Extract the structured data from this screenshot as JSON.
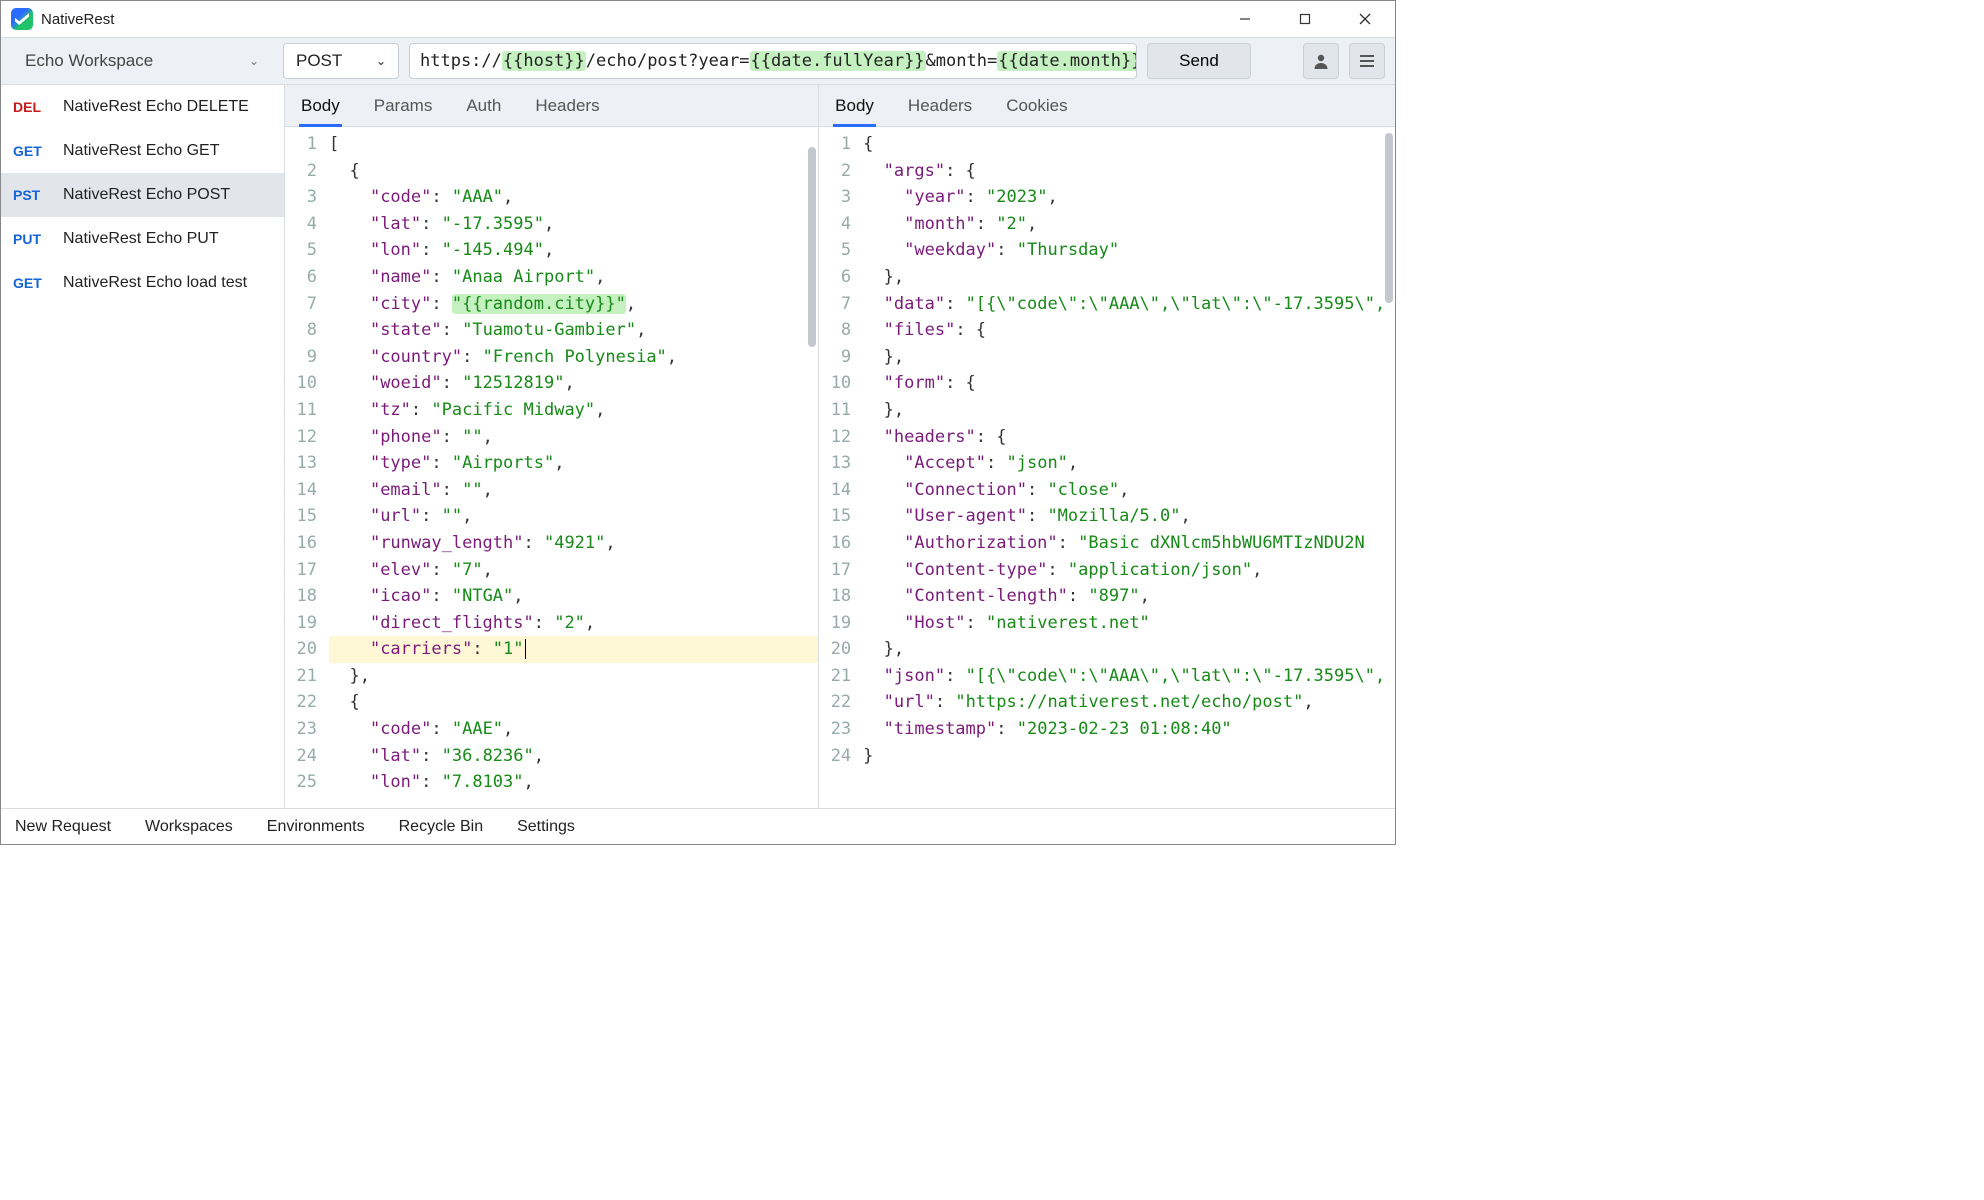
{
  "app": {
    "title": "NativeRest"
  },
  "workspace": {
    "name": "Echo Workspace"
  },
  "request_bar": {
    "method": "POST",
    "url_parts": {
      "p0": "https://",
      "v0": "{{host}}",
      "p1": "/echo/post?year=",
      "v1": "{{date.fullYear}}",
      "p2": "&month=",
      "v2": "{{date.month}}"
    },
    "send": "Send"
  },
  "sidebar": [
    {
      "method": "DEL",
      "cls": "m-del",
      "label": "NativeRest Echo DELETE"
    },
    {
      "method": "GET",
      "cls": "m-get",
      "label": "NativeRest Echo GET"
    },
    {
      "method": "PST",
      "cls": "m-pst",
      "label": "NativeRest Echo POST",
      "selected": true
    },
    {
      "method": "PUT",
      "cls": "m-put",
      "label": "NativeRest Echo PUT"
    },
    {
      "method": "GET",
      "cls": "m-get",
      "label": "NativeRest Echo load test"
    }
  ],
  "req_tabs": [
    "Body",
    "Params",
    "Auth",
    "Headers"
  ],
  "resp_tabs": [
    "Body",
    "Headers",
    "Cookies"
  ],
  "request_body": [
    {
      "n": 1,
      "i": 0,
      "t": [
        [
          "p",
          "["
        ]
      ]
    },
    {
      "n": 2,
      "i": 1,
      "t": [
        [
          "p",
          "{"
        ]
      ]
    },
    {
      "n": 3,
      "i": 2,
      "t": [
        [
          "k",
          "\"code\""
        ],
        [
          "p",
          ": "
        ],
        [
          "s",
          "\"AAA\""
        ],
        [
          "p",
          ","
        ]
      ]
    },
    {
      "n": 4,
      "i": 2,
      "t": [
        [
          "k",
          "\"lat\""
        ],
        [
          "p",
          ": "
        ],
        [
          "s",
          "\"-17.3595\""
        ],
        [
          "p",
          ","
        ]
      ]
    },
    {
      "n": 5,
      "i": 2,
      "t": [
        [
          "k",
          "\"lon\""
        ],
        [
          "p",
          ": "
        ],
        [
          "s",
          "\"-145.494\""
        ],
        [
          "p",
          ","
        ]
      ]
    },
    {
      "n": 6,
      "i": 2,
      "t": [
        [
          "k",
          "\"name\""
        ],
        [
          "p",
          ": "
        ],
        [
          "s",
          "\"Anaa Airport\""
        ],
        [
          "p",
          ","
        ]
      ]
    },
    {
      "n": 7,
      "i": 2,
      "t": [
        [
          "k",
          "\"city\""
        ],
        [
          "p",
          ": "
        ],
        [
          "s v",
          "\"{{random.city}}\""
        ],
        [
          "p",
          ","
        ]
      ]
    },
    {
      "n": 8,
      "i": 2,
      "t": [
        [
          "k",
          "\"state\""
        ],
        [
          "p",
          ": "
        ],
        [
          "s",
          "\"Tuamotu-Gambier\""
        ],
        [
          "p",
          ","
        ]
      ]
    },
    {
      "n": 9,
      "i": 2,
      "t": [
        [
          "k",
          "\"country\""
        ],
        [
          "p",
          ": "
        ],
        [
          "s",
          "\"French Polynesia\""
        ],
        [
          "p",
          ","
        ]
      ]
    },
    {
      "n": 10,
      "i": 2,
      "t": [
        [
          "k",
          "\"woeid\""
        ],
        [
          "p",
          ": "
        ],
        [
          "s",
          "\"12512819\""
        ],
        [
          "p",
          ","
        ]
      ]
    },
    {
      "n": 11,
      "i": 2,
      "t": [
        [
          "k",
          "\"tz\""
        ],
        [
          "p",
          ": "
        ],
        [
          "s",
          "\"Pacific Midway\""
        ],
        [
          "p",
          ","
        ]
      ]
    },
    {
      "n": 12,
      "i": 2,
      "t": [
        [
          "k",
          "\"phone\""
        ],
        [
          "p",
          ": "
        ],
        [
          "s",
          "\"\""
        ],
        [
          "p",
          ","
        ]
      ]
    },
    {
      "n": 13,
      "i": 2,
      "t": [
        [
          "k",
          "\"type\""
        ],
        [
          "p",
          ": "
        ],
        [
          "s",
          "\"Airports\""
        ],
        [
          "p",
          ","
        ]
      ]
    },
    {
      "n": 14,
      "i": 2,
      "t": [
        [
          "k",
          "\"email\""
        ],
        [
          "p",
          ": "
        ],
        [
          "s",
          "\"\""
        ],
        [
          "p",
          ","
        ]
      ]
    },
    {
      "n": 15,
      "i": 2,
      "t": [
        [
          "k",
          "\"url\""
        ],
        [
          "p",
          ": "
        ],
        [
          "s",
          "\"\""
        ],
        [
          "p",
          ","
        ]
      ]
    },
    {
      "n": 16,
      "i": 2,
      "t": [
        [
          "k",
          "\"runway_length\""
        ],
        [
          "p",
          ": "
        ],
        [
          "s",
          "\"4921\""
        ],
        [
          "p",
          ","
        ]
      ]
    },
    {
      "n": 17,
      "i": 2,
      "t": [
        [
          "k",
          "\"elev\""
        ],
        [
          "p",
          ": "
        ],
        [
          "s",
          "\"7\""
        ],
        [
          "p",
          ","
        ]
      ]
    },
    {
      "n": 18,
      "i": 2,
      "t": [
        [
          "k",
          "\"icao\""
        ],
        [
          "p",
          ": "
        ],
        [
          "s",
          "\"NTGA\""
        ],
        [
          "p",
          ","
        ]
      ]
    },
    {
      "n": 19,
      "i": 2,
      "t": [
        [
          "k",
          "\"direct_flights\""
        ],
        [
          "p",
          ": "
        ],
        [
          "s",
          "\"2\""
        ],
        [
          "p",
          ","
        ]
      ]
    },
    {
      "n": 20,
      "i": 2,
      "hl": true,
      "cursor": true,
      "t": [
        [
          "k",
          "\"carriers\""
        ],
        [
          "p",
          ": "
        ],
        [
          "s",
          "\"1\""
        ]
      ]
    },
    {
      "n": 21,
      "i": 1,
      "t": [
        [
          "p",
          "},"
        ]
      ]
    },
    {
      "n": 22,
      "i": 1,
      "t": [
        [
          "p",
          "{"
        ]
      ]
    },
    {
      "n": 23,
      "i": 2,
      "t": [
        [
          "k",
          "\"code\""
        ],
        [
          "p",
          ": "
        ],
        [
          "s",
          "\"AAE\""
        ],
        [
          "p",
          ","
        ]
      ]
    },
    {
      "n": 24,
      "i": 2,
      "t": [
        [
          "k",
          "\"lat\""
        ],
        [
          "p",
          ": "
        ],
        [
          "s",
          "\"36.8236\""
        ],
        [
          "p",
          ","
        ]
      ]
    },
    {
      "n": 25,
      "i": 2,
      "t": [
        [
          "k",
          "\"lon\""
        ],
        [
          "p",
          ": "
        ],
        [
          "s",
          "\"7.8103\""
        ],
        [
          "p",
          ","
        ]
      ]
    }
  ],
  "response_body": [
    {
      "n": 1,
      "i": 0,
      "t": [
        [
          "p",
          "{"
        ]
      ]
    },
    {
      "n": 2,
      "i": 1,
      "t": [
        [
          "k",
          "\"args\""
        ],
        [
          "p",
          ": {"
        ]
      ]
    },
    {
      "n": 3,
      "i": 2,
      "t": [
        [
          "k",
          "\"year\""
        ],
        [
          "p",
          ": "
        ],
        [
          "s",
          "\"2023\""
        ],
        [
          "p",
          ","
        ]
      ]
    },
    {
      "n": 4,
      "i": 2,
      "t": [
        [
          "k",
          "\"month\""
        ],
        [
          "p",
          ": "
        ],
        [
          "s",
          "\"2\""
        ],
        [
          "p",
          ","
        ]
      ]
    },
    {
      "n": 5,
      "i": 2,
      "t": [
        [
          "k",
          "\"weekday\""
        ],
        [
          "p",
          ": "
        ],
        [
          "s",
          "\"Thursday\""
        ]
      ]
    },
    {
      "n": 6,
      "i": 1,
      "t": [
        [
          "p",
          "},"
        ]
      ]
    },
    {
      "n": 7,
      "i": 1,
      "t": [
        [
          "k",
          "\"data\""
        ],
        [
          "p",
          ": "
        ],
        [
          "s",
          "\"[{\\\"code\\\":\\\"AAA\\\",\\\"lat\\\":\\\"-17.3595\\\","
        ],
        [
          "p",
          ""
        ]
      ]
    },
    {
      "n": 8,
      "i": 1,
      "t": [
        [
          "k",
          "\"files\""
        ],
        [
          "p",
          ": {"
        ]
      ]
    },
    {
      "n": 9,
      "i": 1,
      "t": [
        [
          "p",
          "},"
        ]
      ]
    },
    {
      "n": 10,
      "i": 1,
      "t": [
        [
          "k",
          "\"form\""
        ],
        [
          "p",
          ": {"
        ]
      ]
    },
    {
      "n": 11,
      "i": 1,
      "t": [
        [
          "p",
          "},"
        ]
      ]
    },
    {
      "n": 12,
      "i": 1,
      "t": [
        [
          "k",
          "\"headers\""
        ],
        [
          "p",
          ": {"
        ]
      ]
    },
    {
      "n": 13,
      "i": 2,
      "t": [
        [
          "k",
          "\"Accept\""
        ],
        [
          "p",
          ": "
        ],
        [
          "s",
          "\"json\""
        ],
        [
          "p",
          ","
        ]
      ]
    },
    {
      "n": 14,
      "i": 2,
      "t": [
        [
          "k",
          "\"Connection\""
        ],
        [
          "p",
          ": "
        ],
        [
          "s",
          "\"close\""
        ],
        [
          "p",
          ","
        ]
      ]
    },
    {
      "n": 15,
      "i": 2,
      "t": [
        [
          "k",
          "\"User-agent\""
        ],
        [
          "p",
          ": "
        ],
        [
          "s",
          "\"Mozilla/5.0\""
        ],
        [
          "p",
          ","
        ]
      ]
    },
    {
      "n": 16,
      "i": 2,
      "t": [
        [
          "k",
          "\"Authorization\""
        ],
        [
          "p",
          ": "
        ],
        [
          "s",
          "\"Basic dXNlcm5hbWU6MTIzNDU2N"
        ]
      ]
    },
    {
      "n": 17,
      "i": 2,
      "t": [
        [
          "k",
          "\"Content-type\""
        ],
        [
          "p",
          ": "
        ],
        [
          "s",
          "\"application/json\""
        ],
        [
          "p",
          ","
        ]
      ]
    },
    {
      "n": 18,
      "i": 2,
      "t": [
        [
          "k",
          "\"Content-length\""
        ],
        [
          "p",
          ": "
        ],
        [
          "s",
          "\"897\""
        ],
        [
          "p",
          ","
        ]
      ]
    },
    {
      "n": 19,
      "i": 2,
      "t": [
        [
          "k",
          "\"Host\""
        ],
        [
          "p",
          ": "
        ],
        [
          "s",
          "\"nativerest.net\""
        ]
      ]
    },
    {
      "n": 20,
      "i": 1,
      "t": [
        [
          "p",
          "},"
        ]
      ]
    },
    {
      "n": 21,
      "i": 1,
      "t": [
        [
          "k",
          "\"json\""
        ],
        [
          "p",
          ": "
        ],
        [
          "s",
          "\"[{\\\"code\\\":\\\"AAA\\\",\\\"lat\\\":\\\"-17.3595\\\","
        ]
      ]
    },
    {
      "n": 22,
      "i": 1,
      "t": [
        [
          "k",
          "\"url\""
        ],
        [
          "p",
          ": "
        ],
        [
          "s",
          "\"https://nativerest.net/echo/post\""
        ],
        [
          "p",
          ","
        ]
      ]
    },
    {
      "n": 23,
      "i": 1,
      "t": [
        [
          "k",
          "\"timestamp\""
        ],
        [
          "p",
          ": "
        ],
        [
          "s",
          "\"2023-02-23 01:08:40\""
        ]
      ]
    },
    {
      "n": 24,
      "i": 0,
      "t": [
        [
          "p",
          "}"
        ]
      ]
    }
  ],
  "footer": [
    "New Request",
    "Workspaces",
    "Environments",
    "Recycle Bin",
    "Settings"
  ]
}
